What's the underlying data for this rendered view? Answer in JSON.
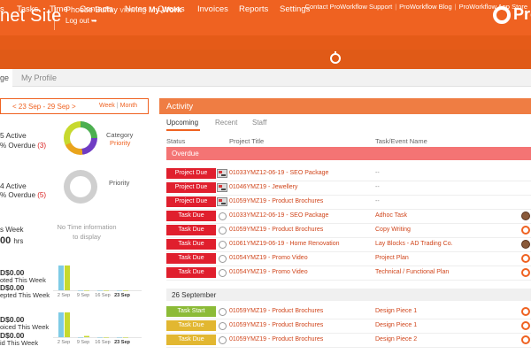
{
  "header": {
    "site_title": "net Site",
    "user_name": "Phoebe Buffay",
    "viewing_word": "viewing",
    "view_name": "My Work",
    "logout_label": "Log out",
    "logo_text": "Pro"
  },
  "support_links": [
    "Contact ProWorkflow Support",
    "ProWorkflow Blog",
    "ProWorkflow App Store"
  ],
  "nav": [
    "s",
    "Tasks",
    "Time",
    "Contacts",
    "Notes",
    "Quotes",
    "Invoices",
    "Reports",
    "Settings"
  ],
  "subtabs": [
    "ge",
    "My Profile"
  ],
  "left_panel": {
    "date_range": "< 23 Sep - 29 Sep >",
    "week_label": "Week",
    "month_label": "Month",
    "projects": {
      "active": "5 Active",
      "overdue_text": "% Overdue",
      "overdue_count": "(3)",
      "donut_label_1": "Category",
      "donut_label_2": "Priority"
    },
    "tasks": {
      "active": "4 Active",
      "overdue_text": "% Overdue",
      "overdue_count": "(5)",
      "donut_label": "Priority"
    },
    "time": {
      "this_week": "s Week",
      "hrs_value": "00",
      "hrs_unit": "hrs",
      "no_time_msg": "No Time information to display"
    },
    "quoted": {
      "amount": "D$0.00",
      "label": "oted This Week"
    },
    "accepted": {
      "amount": "D$0.00",
      "label": "epted This Week"
    },
    "invoiced": {
      "amount": "D$0.00",
      "label": "oiced This Week"
    },
    "paid": {
      "amount": "D$0.00",
      "label": "id This Week"
    }
  },
  "activity": {
    "title": "Activity",
    "tabs": [
      "Upcoming",
      "Recent",
      "Staff"
    ],
    "columns": [
      "Status",
      "Project Title",
      "Task/Event Name"
    ],
    "overdue_label": "Overdue",
    "date_group": "26 September",
    "rows": [
      {
        "status": "Project Due",
        "kind": "red",
        "icon": "project-icon",
        "project": "01033YMZ12-06-19 - SEO Package",
        "task": "--",
        "avatar": "none"
      },
      {
        "status": "Project Due",
        "kind": "red",
        "icon": "project-icon",
        "project": "01046YMZ19 - Jewellery",
        "task": "--",
        "avatar": "none"
      },
      {
        "status": "Project Due",
        "kind": "red",
        "icon": "project-icon",
        "project": "01059YMZ19 - Product Brochures",
        "task": "--",
        "avatar": "none"
      },
      {
        "status": "Task Due",
        "kind": "red",
        "icon": "task-circle-icon",
        "project": "01033YMZ12-06-19 - SEO Package",
        "task": "Adhoc Task",
        "avatar": "person"
      },
      {
        "status": "Task Due",
        "kind": "red",
        "icon": "task-circle-icon",
        "project": "01059YMZ19 - Product Brochures",
        "task": "Copy Writing",
        "avatar": "gear"
      },
      {
        "status": "Task Due",
        "kind": "red",
        "icon": "task-circle-icon",
        "project": "01061YMZ19-06-19 - Home Renovation",
        "task": "Lay Blocks - AD Trading Co.",
        "avatar": "person"
      },
      {
        "status": "Task Due",
        "kind": "red",
        "icon": "task-circle-icon",
        "project": "01054YMZ19 - Promo Video",
        "task": "Project Plan",
        "avatar": "gear"
      },
      {
        "status": "Task Due",
        "kind": "red",
        "icon": "task-circle-icon",
        "project": "01054YMZ19 - Promo Video",
        "task": "Technical / Functional Plan",
        "avatar": "gear"
      },
      {
        "status": "Task Start",
        "kind": "green",
        "icon": "task-circle-icon",
        "project": "01059YMZ19 - Product Brochures",
        "task": "Design Piece 1",
        "avatar": "gear"
      },
      {
        "status": "Task Due",
        "kind": "yellow",
        "icon": "task-circle-icon",
        "project": "01059YMZ19 - Product Brochures",
        "task": "Design Piece 1",
        "avatar": "gear"
      },
      {
        "status": "Task Due",
        "kind": "yellow",
        "icon": "task-circle-icon",
        "project": "01059YMZ19 - Product Brochures",
        "task": "Design Piece 2",
        "avatar": "gear"
      }
    ]
  },
  "colors": {
    "brand_orange": "#ef6221",
    "overdue_red": "#e01f2d",
    "task_start_green": "#8cbb37",
    "task_due_yellow": "#e2b731",
    "link_orange": "#d0451b"
  },
  "chart_data": [
    {
      "type": "bar",
      "categories": [
        "2 Sep",
        "9 Sep",
        "16 Sep",
        "23 Sep"
      ],
      "series": [
        {
          "values": [
            1.0,
            0,
            0,
            0
          ],
          "color": "#7ecbe6"
        },
        {
          "values": [
            1.0,
            0,
            0,
            0
          ],
          "color": "#c7d92e"
        }
      ],
      "ylim": [
        0,
        1
      ]
    },
    {
      "type": "bar",
      "categories": [
        "2 Sep",
        "9 Sep",
        "16 Sep",
        "23 Sep"
      ],
      "series": [
        {
          "values": [
            1.0,
            0,
            0,
            0
          ],
          "color": "#7ecbe6"
        },
        {
          "values": [
            1.0,
            0.05,
            0,
            0
          ],
          "color": "#c7d92e"
        }
      ],
      "ylim": [
        0,
        1
      ]
    }
  ]
}
